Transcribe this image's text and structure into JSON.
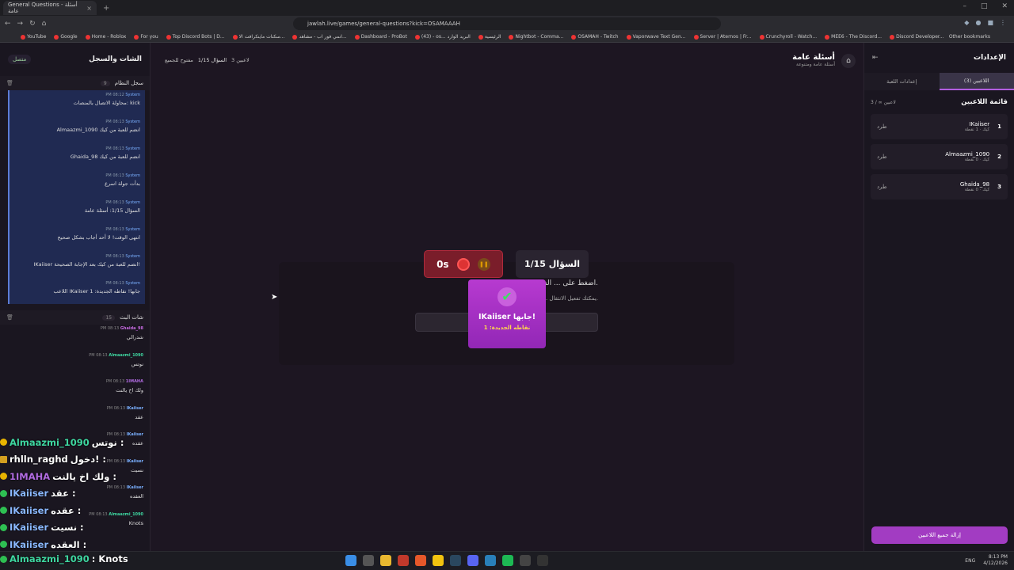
{
  "browser": {
    "tab_title": "General Questions - أسئلة عامة",
    "url": "jawlah.live/games/general-questions?kick=OSAMAAAH",
    "bookmarks": [
      "YouTube",
      "Google",
      "Home - Roblox",
      "For you",
      "Top Discord Bots | D...",
      "سكنات ماينكرافت الا...",
      "انمي فور اب - مشاهد...",
      "Dashboard - ProBot",
      "(43) - os... البريد الوارد",
      "الرئيسية",
      "Nightbot - Comma...",
      "OSAMAH - Twitch",
      "Vaporwave Text Gen...",
      "Server | Aternos | Fr...",
      "Crunchyroll - Watch...",
      "MEE6 - The Discord...",
      "Discord Developer..."
    ],
    "other_bookmarks": "Other bookmarks"
  },
  "left": {
    "title": "الشات والسجل",
    "status": "متصل",
    "syslog_title": "سجل النظام",
    "syslog_count": "9",
    "system_msgs": [
      {
        "who": "System",
        "time": "PM 08:12",
        "text": "محاولة الاتصال بالمنصات: kick"
      },
      {
        "who": "System",
        "time": "PM 08:13",
        "text": "Almaazmi_1090 انضم للعبة من كيك"
      },
      {
        "who": "System",
        "time": "PM 08:13",
        "text": "Ghaida_98 انضم للعبة من كيك"
      },
      {
        "who": "System",
        "time": "PM 08:13",
        "text": "بدأت جولة اسرع"
      },
      {
        "who": "System",
        "time": "PM 08:13",
        "text": "السؤال 1/15: أسئلة عامة"
      },
      {
        "who": "System",
        "time": "PM 08:13",
        "text": "انتهى الوقت! لا أحد أجاب بشكل صحيح"
      },
      {
        "who": "System",
        "time": "PM 08:13",
        "text": "IKaiiser انضم للعبة من كيك بعد الإجابة الصحيحة!"
      },
      {
        "who": "System",
        "time": "PM 08:13",
        "text": "اللاعب IKaiiser جابها! نقاطه الجديدة: 1"
      }
    ],
    "chat_title": "شات البث",
    "chat_count": "15",
    "chat_msgs": [
      {
        "user": "Ghaida_98",
        "color": "#c66be0",
        "time": "PM 08:13",
        "text": "شدرالي"
      },
      {
        "user": "Almaazmi_1090",
        "color": "#3ed6a0",
        "time": "PM 08:13",
        "text": "نوتس"
      },
      {
        "user": "1IMAHA",
        "color": "#b06be0",
        "time": "PM 08:13",
        "text": "ولك اخ يالنت"
      },
      {
        "user": "IKaiiser",
        "color": "#7ab0ff",
        "time": "PM 08:13",
        "text": "عقد"
      },
      {
        "user": "IKaiiser",
        "color": "#7ab0ff",
        "time": "PM 08:13",
        "text": "عقده"
      },
      {
        "user": "IKaiiser",
        "color": "#7ab0ff",
        "time": "PM 08:13",
        "text": "نسيت"
      },
      {
        "user": "IKaiiser",
        "color": "#7ab0ff",
        "time": "PM 08:13",
        "text": "العقده"
      },
      {
        "user": "Almaazmi_1090",
        "color": "#3ed6a0",
        "time": "PM 08:13",
        "text": "Knots"
      }
    ]
  },
  "overlay": [
    {
      "user": "Almaazmi_1090",
      "color": "#3ed6a0",
      "text": "نوتس :"
    },
    {
      "user": "rhlln_raghd",
      "color": "#ffffff",
      "text": "دخول! :"
    },
    {
      "user": "1IMAHA",
      "color": "#b06be0",
      "text": "ولك اخ يالنت :"
    },
    {
      "user": "IKaiiser",
      "color": "#8ab8ff",
      "text": "عقد :"
    },
    {
      "user": "IKaiiser",
      "color": "#8ab8ff",
      "text": "عقده :"
    },
    {
      "user": "IKaiiser",
      "color": "#8ab8ff",
      "text": "نسيت :"
    },
    {
      "user": "IKaiiser",
      "color": "#8ab8ff",
      "text": "العقده :"
    },
    {
      "user": "Almaazmi_1090",
      "color": "#3ed6a0",
      "text": ": Knots"
    }
  ],
  "center": {
    "game_title": "أسئلة عامة",
    "game_sub": "أسئلة عامة ومتنوعة",
    "players_info": "3 لاعبين",
    "question_info": "السؤال 1/15",
    "open_info": "مفتوح للجميع",
    "question_label": "السؤال 1/15",
    "timer": "0s",
    "card_line1": "اضغط على ... السؤال القادم.",
    "card_line2": "يمكنك تفعيل الانتقال ... من إعدادات اللعبة.",
    "toast_winner": "IKaiiser جابها!",
    "toast_points": "نقاطه الجديدة: 1"
  },
  "right": {
    "title": "الإعدادات",
    "tab_players": "اللاعبين (3)",
    "tab_settings": "إعدادات اللعبة",
    "list_title": "قائمة اللاعبين",
    "list_count": "3 / ∞ لاعبين",
    "kick": "طرد",
    "players": [
      {
        "rank": "1",
        "name": "IKaiiser",
        "score": "كيك · 1 نقطة"
      },
      {
        "rank": "2",
        "name": "Almaazmi_1090",
        "score": "كيك · 0 نقطة"
      },
      {
        "rank": "3",
        "name": "Ghaida_98",
        "score": "كيك · 0 نقطة"
      }
    ],
    "clear_btn": "إزالة جميع اللاعبين"
  },
  "taskbar": {
    "lang": "ENG",
    "time": "8:13 PM",
    "date": "4/12/2026"
  }
}
